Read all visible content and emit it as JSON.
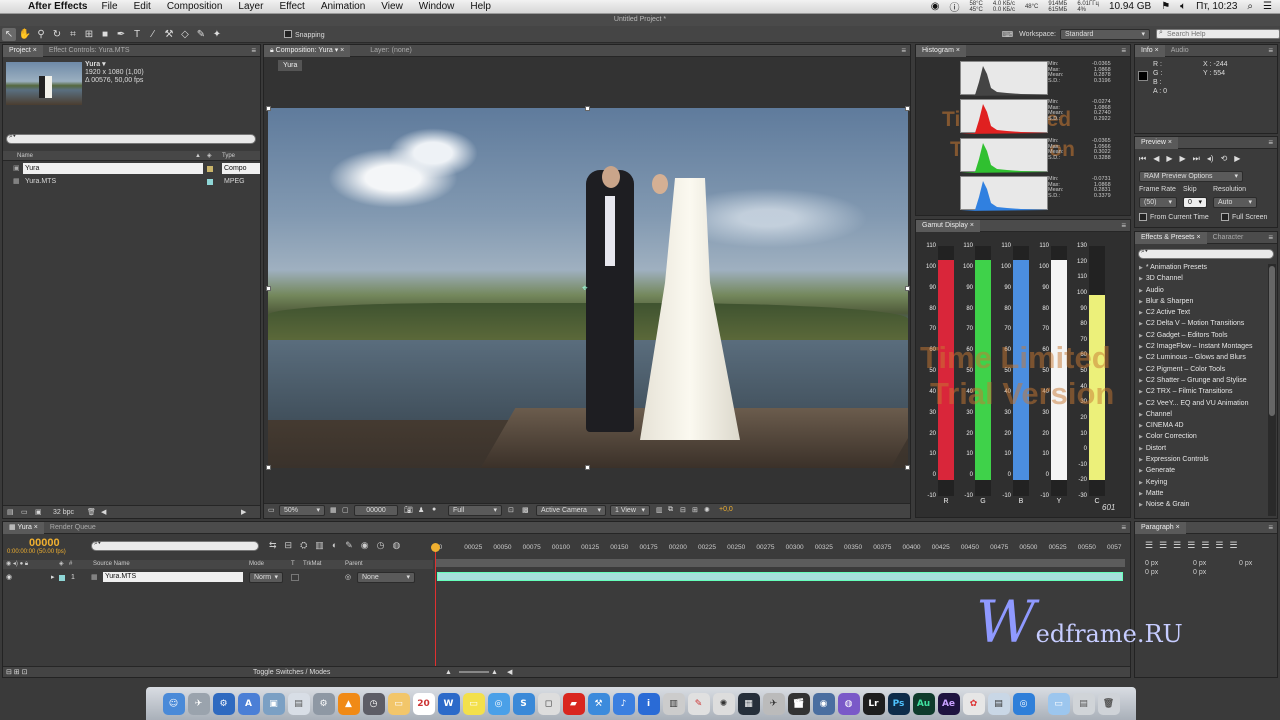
{
  "menubar": {
    "app_name": "After Effects",
    "items": [
      "File",
      "Edit",
      "Composition",
      "Layer",
      "Effect",
      "Animation",
      "View",
      "Window",
      "Help"
    ],
    "status_temp_1": "58°C",
    "status_temp_2": "45°C",
    "status_net_1": "4.0 КБ/с",
    "status_net_2": "0.0 КБ/с",
    "status_temp_3": "48°C",
    "status_mem_1": "914МБ",
    "status_mem_2": "615МБ",
    "status_ghz": "6.01ГГц",
    "status_cpu": "4%",
    "disk": "10.94 GB",
    "clock": "Пт, 10:23"
  },
  "title_strip": "Untitled Project *",
  "toolbar": {
    "snapping_label": "Snapping",
    "workspace_label": "Workspace:",
    "workspace_value": "Standard",
    "search_help_placeholder": "Search Help"
  },
  "project_panel": {
    "tab_project": "Project",
    "tab_effect_controls": "Effect Controls: Yura.MTS",
    "item_name": "Yura ▾",
    "item_res": "1920 x 1080 (1,00)",
    "item_dur": "Δ 00576, 50,00 fps",
    "col_name": "Name",
    "col_type": "Type",
    "rows": [
      {
        "name": "Yura",
        "type": "Compo"
      },
      {
        "name": "Yura.MTS",
        "type": "MPEG"
      }
    ],
    "bpc": "32 bpc"
  },
  "comp_panel": {
    "tab_comp": "Composition: Yura",
    "tab_layer": "Layer: (none)",
    "breadcrumb": "Yura",
    "zoom": "50%",
    "timecode": "00000",
    "resolution": "Full",
    "camera": "Active Camera",
    "views": "1 View",
    "exposure": "+0,0",
    "watermark_line1": "Time Limited",
    "watermark_line2": "Trial Version"
  },
  "histogram": {
    "tab": "Histogram",
    "channels": [
      {
        "min": "-0.0365",
        "max": "1.0868",
        "mean": "0.2878",
        "sd": "0.3196",
        "color": "#eeeeee"
      },
      {
        "min": "-0.0274",
        "max": "1.0868",
        "mean": "0.2740",
        "sd": "0.2922",
        "color": "#e02020"
      },
      {
        "min": "-0.0365",
        "max": "1.0566",
        "mean": "0.3022",
        "sd": "0.3288",
        "color": "#30c030"
      },
      {
        "min": "-0.0731",
        "max": "1.0868",
        "mean": "0.2831",
        "sd": "0.3379",
        "color": "#3080e0"
      }
    ],
    "stat_labels": [
      "Min:",
      "Max:",
      "Mean:",
      "S.D.:"
    ],
    "watermark_line1": "Time Limited",
    "watermark_line2": "Trial Version"
  },
  "gamut": {
    "tab": "Gamut Display",
    "rgb_scale": [
      "110",
      "100",
      "90",
      "80",
      "70",
      "60",
      "50",
      "40",
      "30",
      "20",
      "10",
      "0",
      "-10"
    ],
    "c_scale": [
      "130",
      "120",
      "110",
      "100",
      "90",
      "80",
      "70",
      "60",
      "50",
      "40",
      "30",
      "20",
      "10",
      "0",
      "-10",
      "-20",
      "-30"
    ],
    "bars": [
      {
        "label": "R",
        "level": 0.88,
        "color": "#d9263a"
      },
      {
        "label": "G",
        "level": 0.88,
        "color": "#3fd24a"
      },
      {
        "label": "B",
        "level": 0.88,
        "color": "#4b8ee0"
      },
      {
        "label": "Y",
        "level": 0.88,
        "color": "#f4f4f4"
      },
      {
        "label": "C",
        "level": 0.74,
        "color": "#ecf07a"
      }
    ],
    "frame_counter": "601",
    "watermark_line1": "Time Limited",
    "watermark_line2": "Trial Version"
  },
  "info_panel": {
    "tab_info": "Info",
    "tab_audio": "Audio",
    "r": "R :",
    "g": "G :",
    "b": "B :",
    "a": "A : 0",
    "x": "X : -244",
    "y": "Y : 554"
  },
  "preview_panel": {
    "tab": "Preview",
    "ram_options": "RAM Preview Options",
    "frame_rate_label": "Frame Rate",
    "skip_label": "Skip",
    "resolution_label": "Resolution",
    "frame_rate_value": "(50)",
    "skip_value": "0",
    "resolution_value": "Auto",
    "from_current": "From Current Time",
    "full_screen": "Full Screen"
  },
  "effects_panel": {
    "tab_effects": "Effects & Presets",
    "tab_character": "Character",
    "items": [
      "* Animation Presets",
      "3D Channel",
      "Audio",
      "Blur & Sharpen",
      "C2 Active Text",
      "C2 Delta V – Motion Transitions",
      "C2 Gadget – Editors Tools",
      "C2 ImageFlow – Instant Montages",
      "C2 Luminous – Glows and Blurs",
      "C2 Pigment – Color Tools",
      "C2 Shatter – Grunge and Stylise",
      "C2 TRX – Filmic Transitions",
      "C2 VeeY... EQ and VU Animation",
      "Channel",
      "CINEMA 4D",
      "Color Correction",
      "Distort",
      "Expression Controls",
      "Generate",
      "Keying",
      "Matte",
      "Noise & Grain"
    ]
  },
  "timeline": {
    "tab_comp": "Yura",
    "tab_render": "Render Queue",
    "timecode": "00000",
    "timecode_sub": "0:00:00:00 (50.00 fps)",
    "col_source": "Source Name",
    "col_mode": "Mode",
    "col_t": "T",
    "col_trkmat": "TrkMat",
    "col_parent": "Parent",
    "layer_num": "1",
    "layer_name": "Yura.MTS",
    "layer_mode": "Norm",
    "layer_parent": "None",
    "toggle_label": "Toggle Switches / Modes",
    "ruler": [
      "00",
      "00025",
      "00050",
      "00075",
      "00100",
      "00125",
      "00150",
      "00175",
      "00200",
      "00225",
      "00250",
      "00275",
      "00300",
      "00325",
      "00350",
      "00375",
      "00400",
      "00425",
      "00450",
      "00475",
      "00500",
      "00525",
      "00550",
      "0057"
    ]
  },
  "paragraph_panel": {
    "tab": "Paragraph",
    "values": [
      "0 px",
      "0 px",
      "0 px",
      "0 px",
      "0 px"
    ]
  },
  "overlay_logo": {
    "letter": "W",
    "text": "edframe.RU"
  },
  "dock": {
    "labeled_icons": [
      "20",
      "W",
      "Lr",
      "Ps",
      "Au",
      "Ae"
    ]
  }
}
